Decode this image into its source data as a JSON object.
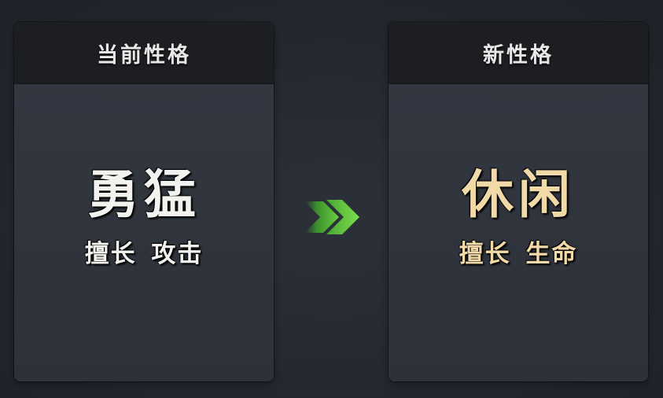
{
  "current_panel": {
    "title": "当前性格",
    "trait_name": "勇猛",
    "trait_desc": "擅长 攻击"
  },
  "new_panel": {
    "title": "新性格",
    "trait_name": "休闲",
    "trait_desc": "擅长 生命"
  },
  "transition": {
    "icon": "double-chevron-right-icon",
    "color": "#5cc83a"
  },
  "colors": {
    "current_text": "#f2f2ee",
    "new_text": "#f1d9a8",
    "panel_header": "#1c1e22",
    "panel_body": "#2e333b"
  }
}
